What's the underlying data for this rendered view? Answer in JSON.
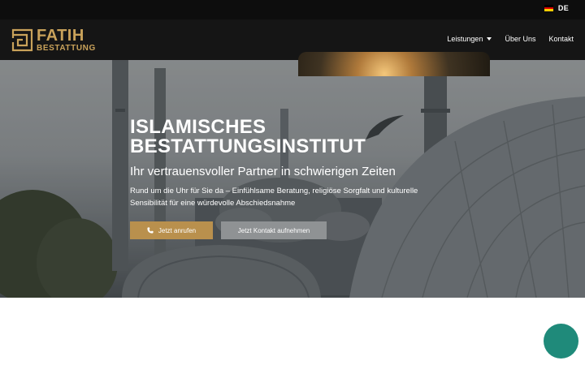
{
  "topbar": {
    "language": "DE"
  },
  "logo": {
    "name": "FATIH",
    "subtitle": "BESTATTUNG"
  },
  "nav": {
    "items": [
      {
        "label": "Leistungen"
      },
      {
        "label": "Über Uns"
      },
      {
        "label": "Kontakt"
      }
    ]
  },
  "hero": {
    "title_line1": "ISLAMISCHES",
    "title_line2": "BESTATTUNGSINSTITUT",
    "subtitle": "Ihr vertrauensvoller Partner in schwierigen Zeiten",
    "description": "Rund um die Uhr für Sie da – Einfühlsame Beratung, religiöse Sorgfalt und kulturelle Sensibilität für eine würdevolle Abschiedsnahme",
    "call_button": "Jetzt anrufen",
    "contact_button": "Jetzt Kontakt aufnehmen"
  },
  "icons": {
    "flag": "germany-flag-icon",
    "phone": "phone-icon",
    "nav_dropdown": "caret-down-icon",
    "chat": "chat-bubble-icon"
  },
  "colors": {
    "accent_gold": "#c9a25a",
    "button_gold": "#b9904d",
    "button_grey": "#8f9294",
    "header_bg": "#151515",
    "topbar_bg": "#0d0d0d",
    "chat_teal": "#1f8a7a"
  }
}
